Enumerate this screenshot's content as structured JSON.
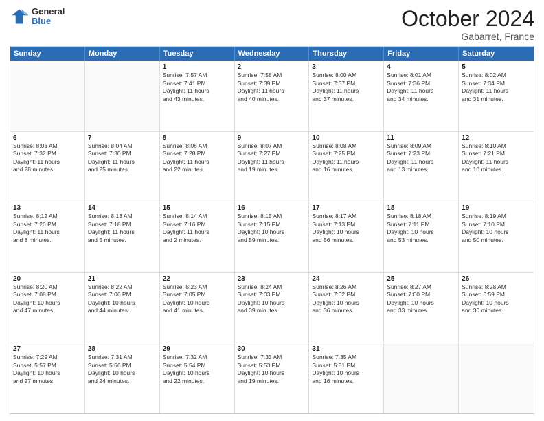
{
  "header": {
    "logo_general": "General",
    "logo_blue": "Blue",
    "month": "October 2024",
    "location": "Gabarret, France"
  },
  "days_of_week": [
    "Sunday",
    "Monday",
    "Tuesday",
    "Wednesday",
    "Thursday",
    "Friday",
    "Saturday"
  ],
  "rows": [
    [
      {
        "day": "",
        "lines": []
      },
      {
        "day": "",
        "lines": []
      },
      {
        "day": "1",
        "lines": [
          "Sunrise: 7:57 AM",
          "Sunset: 7:41 PM",
          "Daylight: 11 hours",
          "and 43 minutes."
        ]
      },
      {
        "day": "2",
        "lines": [
          "Sunrise: 7:58 AM",
          "Sunset: 7:39 PM",
          "Daylight: 11 hours",
          "and 40 minutes."
        ]
      },
      {
        "day": "3",
        "lines": [
          "Sunrise: 8:00 AM",
          "Sunset: 7:37 PM",
          "Daylight: 11 hours",
          "and 37 minutes."
        ]
      },
      {
        "day": "4",
        "lines": [
          "Sunrise: 8:01 AM",
          "Sunset: 7:36 PM",
          "Daylight: 11 hours",
          "and 34 minutes."
        ]
      },
      {
        "day": "5",
        "lines": [
          "Sunrise: 8:02 AM",
          "Sunset: 7:34 PM",
          "Daylight: 11 hours",
          "and 31 minutes."
        ]
      }
    ],
    [
      {
        "day": "6",
        "lines": [
          "Sunrise: 8:03 AM",
          "Sunset: 7:32 PM",
          "Daylight: 11 hours",
          "and 28 minutes."
        ]
      },
      {
        "day": "7",
        "lines": [
          "Sunrise: 8:04 AM",
          "Sunset: 7:30 PM",
          "Daylight: 11 hours",
          "and 25 minutes."
        ]
      },
      {
        "day": "8",
        "lines": [
          "Sunrise: 8:06 AM",
          "Sunset: 7:28 PM",
          "Daylight: 11 hours",
          "and 22 minutes."
        ]
      },
      {
        "day": "9",
        "lines": [
          "Sunrise: 8:07 AM",
          "Sunset: 7:27 PM",
          "Daylight: 11 hours",
          "and 19 minutes."
        ]
      },
      {
        "day": "10",
        "lines": [
          "Sunrise: 8:08 AM",
          "Sunset: 7:25 PM",
          "Daylight: 11 hours",
          "and 16 minutes."
        ]
      },
      {
        "day": "11",
        "lines": [
          "Sunrise: 8:09 AM",
          "Sunset: 7:23 PM",
          "Daylight: 11 hours",
          "and 13 minutes."
        ]
      },
      {
        "day": "12",
        "lines": [
          "Sunrise: 8:10 AM",
          "Sunset: 7:21 PM",
          "Daylight: 11 hours",
          "and 10 minutes."
        ]
      }
    ],
    [
      {
        "day": "13",
        "lines": [
          "Sunrise: 8:12 AM",
          "Sunset: 7:20 PM",
          "Daylight: 11 hours",
          "and 8 minutes."
        ]
      },
      {
        "day": "14",
        "lines": [
          "Sunrise: 8:13 AM",
          "Sunset: 7:18 PM",
          "Daylight: 11 hours",
          "and 5 minutes."
        ]
      },
      {
        "day": "15",
        "lines": [
          "Sunrise: 8:14 AM",
          "Sunset: 7:16 PM",
          "Daylight: 11 hours",
          "and 2 minutes."
        ]
      },
      {
        "day": "16",
        "lines": [
          "Sunrise: 8:15 AM",
          "Sunset: 7:15 PM",
          "Daylight: 10 hours",
          "and 59 minutes."
        ]
      },
      {
        "day": "17",
        "lines": [
          "Sunrise: 8:17 AM",
          "Sunset: 7:13 PM",
          "Daylight: 10 hours",
          "and 56 minutes."
        ]
      },
      {
        "day": "18",
        "lines": [
          "Sunrise: 8:18 AM",
          "Sunset: 7:11 PM",
          "Daylight: 10 hours",
          "and 53 minutes."
        ]
      },
      {
        "day": "19",
        "lines": [
          "Sunrise: 8:19 AM",
          "Sunset: 7:10 PM",
          "Daylight: 10 hours",
          "and 50 minutes."
        ]
      }
    ],
    [
      {
        "day": "20",
        "lines": [
          "Sunrise: 8:20 AM",
          "Sunset: 7:08 PM",
          "Daylight: 10 hours",
          "and 47 minutes."
        ]
      },
      {
        "day": "21",
        "lines": [
          "Sunrise: 8:22 AM",
          "Sunset: 7:06 PM",
          "Daylight: 10 hours",
          "and 44 minutes."
        ]
      },
      {
        "day": "22",
        "lines": [
          "Sunrise: 8:23 AM",
          "Sunset: 7:05 PM",
          "Daylight: 10 hours",
          "and 41 minutes."
        ]
      },
      {
        "day": "23",
        "lines": [
          "Sunrise: 8:24 AM",
          "Sunset: 7:03 PM",
          "Daylight: 10 hours",
          "and 39 minutes."
        ]
      },
      {
        "day": "24",
        "lines": [
          "Sunrise: 8:26 AM",
          "Sunset: 7:02 PM",
          "Daylight: 10 hours",
          "and 36 minutes."
        ]
      },
      {
        "day": "25",
        "lines": [
          "Sunrise: 8:27 AM",
          "Sunset: 7:00 PM",
          "Daylight: 10 hours",
          "and 33 minutes."
        ]
      },
      {
        "day": "26",
        "lines": [
          "Sunrise: 8:28 AM",
          "Sunset: 6:59 PM",
          "Daylight: 10 hours",
          "and 30 minutes."
        ]
      }
    ],
    [
      {
        "day": "27",
        "lines": [
          "Sunrise: 7:29 AM",
          "Sunset: 5:57 PM",
          "Daylight: 10 hours",
          "and 27 minutes."
        ]
      },
      {
        "day": "28",
        "lines": [
          "Sunrise: 7:31 AM",
          "Sunset: 5:56 PM",
          "Daylight: 10 hours",
          "and 24 minutes."
        ]
      },
      {
        "day": "29",
        "lines": [
          "Sunrise: 7:32 AM",
          "Sunset: 5:54 PM",
          "Daylight: 10 hours",
          "and 22 minutes."
        ]
      },
      {
        "day": "30",
        "lines": [
          "Sunrise: 7:33 AM",
          "Sunset: 5:53 PM",
          "Daylight: 10 hours",
          "and 19 minutes."
        ]
      },
      {
        "day": "31",
        "lines": [
          "Sunrise: 7:35 AM",
          "Sunset: 5:51 PM",
          "Daylight: 10 hours",
          "and 16 minutes."
        ]
      },
      {
        "day": "",
        "lines": []
      },
      {
        "day": "",
        "lines": []
      }
    ]
  ]
}
